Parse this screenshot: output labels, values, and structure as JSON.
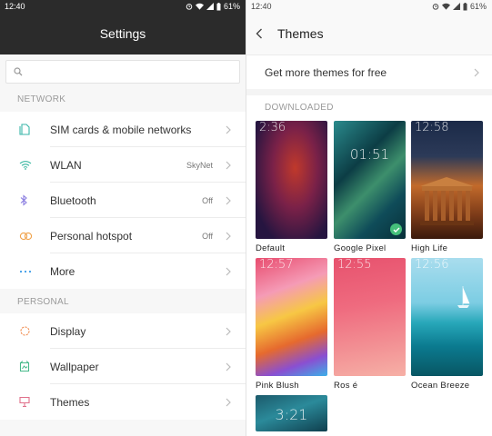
{
  "left": {
    "status": {
      "time": "12:40",
      "battery": "61%"
    },
    "title": "Settings",
    "network_header": "NETWORK",
    "network_items": [
      {
        "label": "SIM cards & mobile networks",
        "value": ""
      },
      {
        "label": "WLAN",
        "value": "SkyNet"
      },
      {
        "label": "Bluetooth",
        "value": "Off"
      },
      {
        "label": "Personal hotspot",
        "value": "Off"
      },
      {
        "label": "More",
        "value": ""
      }
    ],
    "personal_header": "PERSONAL",
    "personal_items": [
      {
        "label": "Display"
      },
      {
        "label": "Wallpaper"
      },
      {
        "label": "Themes"
      }
    ]
  },
  "right": {
    "status": {
      "time": "12:40",
      "battery": "61%"
    },
    "title": "Themes",
    "promo": "Get more themes for free",
    "downloaded_header": "DOWNLOADED",
    "themes": [
      {
        "name": "Default",
        "clock": "2:36",
        "selected": false
      },
      {
        "name": "Google Pixel",
        "clock": "01:51",
        "selected": true
      },
      {
        "name": "High Life",
        "clock": "12:58",
        "selected": false
      },
      {
        "name": "Pink Blush",
        "clock": "12:57",
        "selected": false
      },
      {
        "name": "Ros é",
        "clock": "12:55",
        "selected": false
      },
      {
        "name": "Ocean Breeze",
        "clock": "12:56",
        "selected": false
      },
      {
        "name": "",
        "clock": "3:21",
        "selected": false
      }
    ]
  },
  "colors": {
    "dark_header": "#2b2b2b",
    "accent_green": "#45c07a",
    "sim_icon": "#3ab6a8",
    "wlan_icon": "#36b6a0",
    "bluetooth_icon": "#8a7de0",
    "hotspot_icon": "#f0a24a",
    "more_icon": "#3b9be8",
    "display_icon": "#f08a4b",
    "wallpaper_icon": "#47b98a",
    "themes_icon": "#e0708a"
  }
}
